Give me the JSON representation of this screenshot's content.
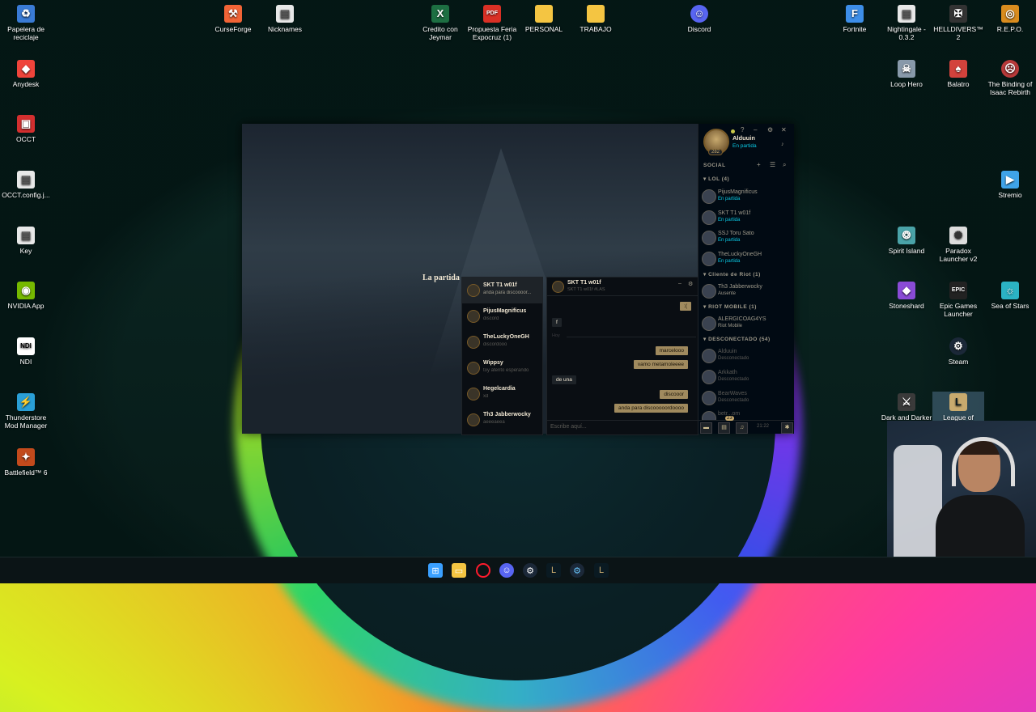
{
  "desktop": {
    "left_icons": [
      {
        "label": "Papelera de reciclaje",
        "icon": "recycle-bin-icon",
        "color": "#3a7bd5"
      },
      {
        "label": "Anydesk",
        "icon": "anydesk-icon",
        "color": "#ef443b"
      },
      {
        "label": "OCCT",
        "icon": "occt-icon",
        "color": "#d32f2f"
      },
      {
        "label": "OCCT.config.j...",
        "icon": "file-icon",
        "color": "#e8e8e8"
      },
      {
        "label": "Key",
        "icon": "file-icon",
        "color": "#e8e8e8"
      },
      {
        "label": "NVIDIA App",
        "icon": "nvidia-icon",
        "color": "#76b900"
      },
      {
        "label": "NDI",
        "icon": "ndi-icon",
        "color": "#ffffff"
      },
      {
        "label": "Thunderstore Mod Manager",
        "icon": "thunderstore-icon",
        "color": "#2a9fd6"
      },
      {
        "label": "Battlefield™ 6",
        "icon": "battlefield-icon",
        "color": "#c24a1c"
      }
    ],
    "top_icons": [
      {
        "label": "CurseForge",
        "icon": "curseforge-icon",
        "color": "#f16436"
      },
      {
        "label": "Nicknames",
        "icon": "file-icon",
        "color": "#e8e8e8"
      },
      {
        "label": "Credito con Jeymar",
        "icon": "excel-icon",
        "color": "#1d6f42"
      },
      {
        "label": "Propuesta Feria Expocruz (1)",
        "icon": "pdf-icon",
        "color": "#d93025"
      },
      {
        "label": "PERSONAL",
        "icon": "folder-icon",
        "color": "#f4c542"
      },
      {
        "label": "TRABAJO",
        "icon": "folder-icon",
        "color": "#f4c542"
      },
      {
        "label": "Discord",
        "icon": "discord-icon",
        "color": "#5865f2"
      },
      {
        "label": "Fortnite",
        "icon": "fortnite-icon",
        "color": "#3d8ee8"
      },
      {
        "label": "Nightingale - 0.3.2",
        "icon": "file-icon",
        "color": "#e8e8e8"
      },
      {
        "label": "HELLDIVERS™ 2",
        "icon": "helldivers-icon",
        "color": "#333333"
      },
      {
        "label": "R.E.P.O.",
        "icon": "repo-icon",
        "color": "#d98c1e"
      }
    ],
    "right_icons": [
      {
        "label": "Loop Hero",
        "icon": "loop-hero-icon",
        "color": "#8899aa"
      },
      {
        "label": "Balatro",
        "icon": "balatro-icon",
        "color": "#d3423c"
      },
      {
        "label": "The Binding of Isaac Rebirth",
        "icon": "isaac-icon",
        "color": "#b83a3a"
      },
      {
        "label": "Stremio",
        "icon": "stremio-icon",
        "color": "#3fa3e8"
      },
      {
        "label": "Spirit Island",
        "icon": "spirit-island-icon",
        "color": "#4aa3a8"
      },
      {
        "label": "Paradox Launcher v2",
        "icon": "paradox-icon",
        "color": "#dddddd"
      },
      {
        "label": "Stoneshard",
        "icon": "stoneshard-icon",
        "color": "#8a4bd6"
      },
      {
        "label": "Epic Games Launcher",
        "icon": "epic-icon",
        "color": "#222222"
      },
      {
        "label": "Sea of Stars",
        "icon": "sea-of-stars-icon",
        "color": "#2bb3c4"
      },
      {
        "label": "Steam",
        "icon": "steam-icon",
        "color": "#1b2838"
      },
      {
        "label": "Dark and Darker",
        "icon": "dark-and-darker-icon",
        "color": "#3a3a3a"
      },
      {
        "label": "League of",
        "icon": "lol-icon",
        "color": "#c8aa6e"
      }
    ]
  },
  "client": {
    "game_text": "La partida",
    "profile": {
      "name": "Alduuin",
      "status": "En partida",
      "level": "282"
    },
    "social_title": "SOCIAL",
    "groups": [
      {
        "title": "LOL (4)"
      },
      {
        "title": "Cliente de Riot (1)"
      },
      {
        "title": "RIOT MOBILE (1)"
      },
      {
        "title": "DESCONECTADO (54)"
      }
    ],
    "friends": [
      {
        "name": "PijusMagnificus",
        "status": "En partida"
      },
      {
        "name": "SKT T1 w01f",
        "status": "En partida"
      },
      {
        "name": "SSJ Toru Sato",
        "status": "En partida"
      },
      {
        "name": "TheLuckyOneGH",
        "status": "En partida"
      },
      {
        "name": "Th3 Jabberwocky",
        "status": "Ausente"
      },
      {
        "name": "ALERGICOAG4YS",
        "status": "Riot Mobile"
      },
      {
        "name": "Alduuin",
        "status": "Desconectado"
      },
      {
        "name": "Arkkath",
        "status": "Desconectado"
      },
      {
        "name": "BearWaves",
        "status": "Desconectado"
      },
      {
        "name": "betr...om",
        "status": ""
      }
    ],
    "bottombar": {
      "badge": "23",
      "clock": "21:22"
    },
    "chat_list": [
      {
        "name": "SKT T1 w01f",
        "preview": "anda para discoooor..."
      },
      {
        "name": "PijusMagnificus",
        "preview": "discord"
      },
      {
        "name": "TheLuckyOneGH",
        "preview": "discordooo"
      },
      {
        "name": "Wippsy",
        "preview": "toy atento esperando"
      },
      {
        "name": "Hegelcardia",
        "preview": "xd"
      },
      {
        "name": "Th3 Jabberwocky",
        "preview": "aeeeaeea"
      }
    ],
    "chat": {
      "name": "SKT T1 w01f",
      "tag": "SKT T1 w01f #LAS",
      "messages": [
        {
          "from": "me",
          "text": ":("
        },
        {
          "from": "them",
          "text": "f"
        },
        {
          "from": "sep",
          "text": "Hoy"
        },
        {
          "from": "me",
          "text": "marcelooo"
        },
        {
          "from": "me",
          "text": "vamo metamoleeee"
        },
        {
          "from": "them",
          "text": "de una"
        },
        {
          "from": "me",
          "text": "discooor"
        },
        {
          "from": "me",
          "text": "anda para discooooordoooo"
        }
      ],
      "input_placeholder": "Escribe aquí..."
    }
  },
  "taskbar": {
    "icons": [
      {
        "name": "windows-start-icon",
        "color": "#3aa0ff"
      },
      {
        "name": "file-explorer-icon",
        "color": "#f4c542"
      },
      {
        "name": "opera-icon",
        "color": "#ff1b2d"
      },
      {
        "name": "discord-icon",
        "color": "#5865f2"
      },
      {
        "name": "steam-icon",
        "color": "#c6d4df"
      },
      {
        "name": "league-client-icon",
        "color": "#c8aa6e"
      },
      {
        "name": "steam-icon",
        "color": "#66c0f4"
      },
      {
        "name": "league-client-icon",
        "color": "#c8aa6e"
      }
    ]
  }
}
